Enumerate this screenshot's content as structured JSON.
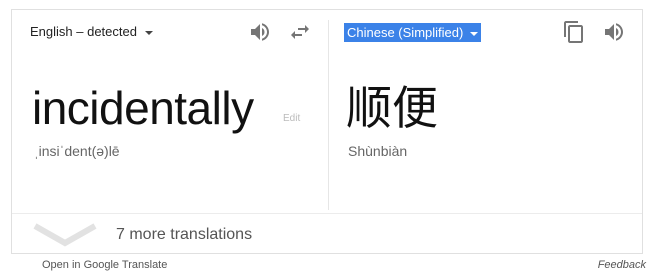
{
  "source": {
    "language_label": "English – detected",
    "word": "incidentally",
    "edit_label": "Edit",
    "phonetic": "ˌinsiˈdent(ə)lē"
  },
  "target": {
    "language_label": "Chinese (Simplified)",
    "word": "顺便",
    "romanization": "Shùnbiàn"
  },
  "icons": {
    "source_listen": "speaker-icon",
    "swap": "swap-languages-icon",
    "copy": "copy-icon",
    "target_listen": "speaker-icon",
    "more_chevron": "chevron-down-icon"
  },
  "more_translations_label": "7 more translations",
  "footer": {
    "open_label": "Open in Google Translate",
    "feedback_label": "Feedback"
  },
  "colors": {
    "selected_language_bg": "#3b82e8",
    "icon_gray": "#757575"
  }
}
